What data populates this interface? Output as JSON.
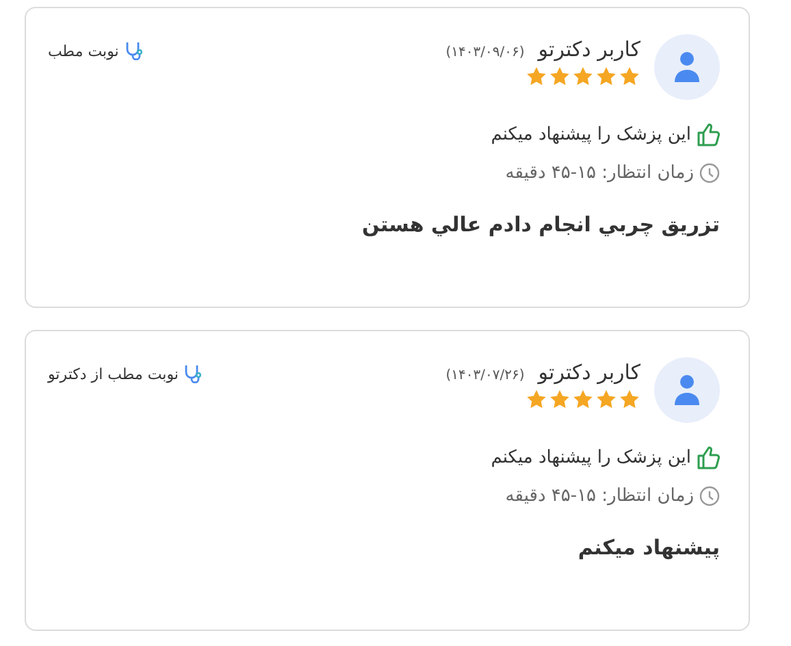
{
  "reviews": [
    {
      "user": "کاربر دکترتو",
      "date": "(۱۴۰۳/۰۹/۰۶)",
      "stars": 5,
      "recommend": "این پزشک را پیشنهاد میکنم",
      "wait": "زمان انتظار: ۱۵-۴۵ دقیقه",
      "comment": "تزریق چربي انجام دادم عالي هستن",
      "booking": "نوبت مطب"
    },
    {
      "user": "کاربر دکترتو",
      "date": "(۱۴۰۳/۰۷/۲۶)",
      "stars": 5,
      "recommend": "این پزشک را پیشنهاد میکنم",
      "wait": "زمان انتظار: ۱۵-۴۵ دقیقه",
      "comment": "پیشنهاد میکنم",
      "booking": "نوبت مطب از دکترتو"
    }
  ]
}
